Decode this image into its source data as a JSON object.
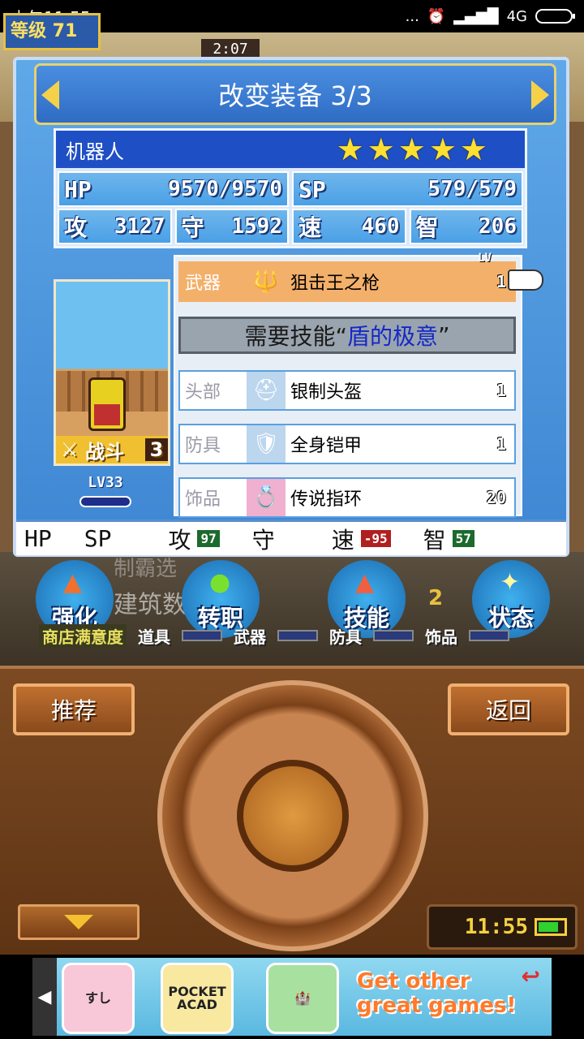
{
  "status_bar": {
    "time": "上午11:55",
    "dots": "...",
    "network": "4G"
  },
  "game_bg": {
    "level_badge": "等级 71",
    "top_clock": "2:07"
  },
  "dialog": {
    "title": "改变装备 3/3",
    "character": {
      "name": "机器人",
      "stars": 5,
      "stars_text": "★",
      "hp_label": "HP",
      "hp_value": "9570/9570",
      "sp_label": "SP",
      "sp_value": "579/579",
      "atk_label": "攻",
      "atk_value": "3127",
      "def_label": "守",
      "def_value": "1592",
      "spd_label": "速",
      "spd_value": "460",
      "int_label": "智",
      "int_value": "206",
      "job": "战斗",
      "job_num": "3",
      "level": "LV33"
    },
    "equipment": [
      {
        "slot": "武器",
        "name": "狙击王之枪",
        "lv": "1",
        "icon": "spear-icon",
        "glyph": "🔱"
      },
      {
        "slot": "头部",
        "name": "银制头盔",
        "lv": "1",
        "icon": "helmet-icon",
        "glyph": "⛑"
      },
      {
        "slot": "防具",
        "name": "全身铠甲",
        "lv": "1",
        "icon": "armor-icon",
        "glyph": "🛡"
      },
      {
        "slot": "饰品",
        "name": "传说指环",
        "lv": "20",
        "icon": "ring-icon",
        "glyph": "💍"
      }
    ],
    "lv_tag": "LV",
    "skill_req": {
      "prefix": "需要技能“",
      "skill": "盾的极意",
      "suffix": "”"
    },
    "bonus": {
      "hp": "HP",
      "sp": "SP",
      "atk": "攻",
      "atk_val": "97",
      "def": "守",
      "spd": "速",
      "spd_val": "-95",
      "int": "智",
      "int_val": "57"
    }
  },
  "menu": {
    "upgrade": "强化",
    "job_change": "转职",
    "skill": "技能",
    "status": "状态",
    "faded_small": "制霸选",
    "faded": "建筑数",
    "faded_num": "2",
    "shop_sat": "商店满意度",
    "cat_item": "道具",
    "cat_weapon": "武器",
    "cat_armor": "防具",
    "cat_acc": "饰品"
  },
  "controls": {
    "recommend": "推荐",
    "back": "返回",
    "game_time": "11:55"
  },
  "ad": {
    "app1": "すし",
    "app2": "POCKET ACAD",
    "app3": "",
    "cta_line1": "Get other",
    "cta_line2": "great games!"
  }
}
